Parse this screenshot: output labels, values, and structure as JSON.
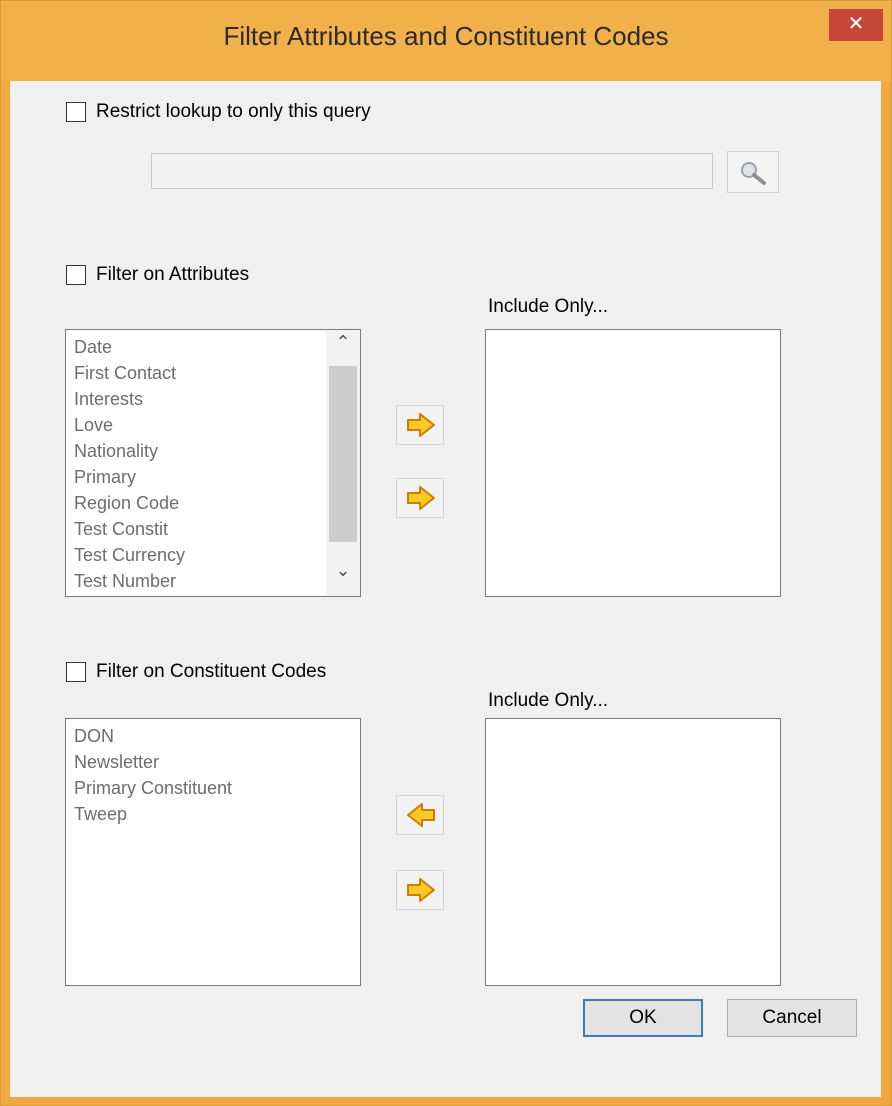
{
  "window": {
    "title": "Filter Attributes and Constituent Codes",
    "close_glyph": "✕"
  },
  "query": {
    "restrict_label": "Restrict lookup to only this query",
    "restrict_checked": false,
    "input_value": "",
    "search_icon": "magnifier-icon"
  },
  "attributes": {
    "filter_label": "Filter on Attributes",
    "filter_checked": false,
    "include_label": "Include Only...",
    "available": [
      "Date",
      "First Contact",
      "Interests",
      "Love",
      "Nationality",
      "Primary",
      "Region Code",
      "Test Constit",
      "Test Currency",
      "Test Number"
    ],
    "included": [],
    "scroll_up_glyph": "⌃",
    "scroll_down_glyph": "⌄"
  },
  "constituent_codes": {
    "filter_label": "Filter on Constituent Codes",
    "filter_checked": false,
    "include_label": "Include Only...",
    "available": [
      "DON",
      "Newsletter",
      "Primary Constituent",
      "Tweep"
    ],
    "included": []
  },
  "buttons": {
    "ok": "OK",
    "cancel": "Cancel"
  },
  "colors": {
    "title_bar": "#f2b04b",
    "close_button": "#c7463a",
    "arrow_fill": "#ffc928",
    "arrow_stroke": "#cf7d00",
    "ok_border": "#3c7fb1"
  }
}
